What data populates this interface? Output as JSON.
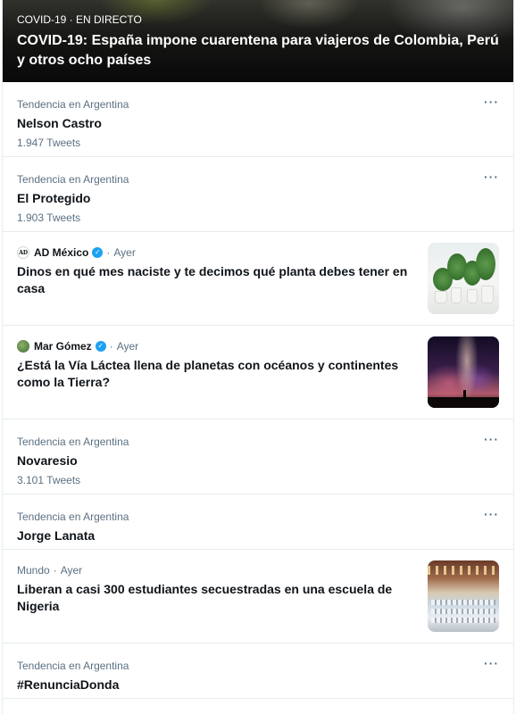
{
  "hero": {
    "meta": "COVID-19 · EN DIRECTO",
    "title": "COVID-19: España impone cuarentena para viajeros de Colombia, Perú y otros ocho países"
  },
  "trends": [
    {
      "meta": "Tendencia en Argentina",
      "title": "Nelson Castro",
      "count": "1.947 Tweets",
      "more": "···"
    },
    {
      "meta": "Tendencia en Argentina",
      "title": "El Protegido",
      "count": "1.903 Tweets",
      "more": "···"
    },
    {
      "meta": "Tendencia en Argentina",
      "title": "Novaresio",
      "count": "3.101 Tweets",
      "more": "···"
    },
    {
      "meta": "Tendencia en Argentina",
      "title": "Jorge Lanata",
      "more": "···"
    },
    {
      "meta": "Tendencia en Argentina",
      "title": "#RenunciaDonda",
      "more": "···"
    }
  ],
  "news": [
    {
      "source": "AD México",
      "avatar_text": "AD",
      "verified": true,
      "time": "Ayer",
      "headline": "Dinos en qué mes naciste y te decimos qué planta debes tener en casa",
      "thumb": "plants-image"
    },
    {
      "source": "Mar Gómez",
      "verified": true,
      "time": "Ayer",
      "headline": "¿Está la Vía Láctea llena de planetas con océanos y continentes como la Tierra?",
      "thumb": "milky-way-image"
    },
    {
      "source": "Mundo",
      "time": "Ayer",
      "headline": "Liberan a casi 300 estudiantes secuestradas en una escuela de Nigeria",
      "thumb": "school-hall-image"
    }
  ],
  "separator": "·",
  "verified_glyph": "✓",
  "colors": {
    "accent": "#1da1f2",
    "secondary_text": "#5b7083",
    "divider": "#e6ecf0"
  }
}
